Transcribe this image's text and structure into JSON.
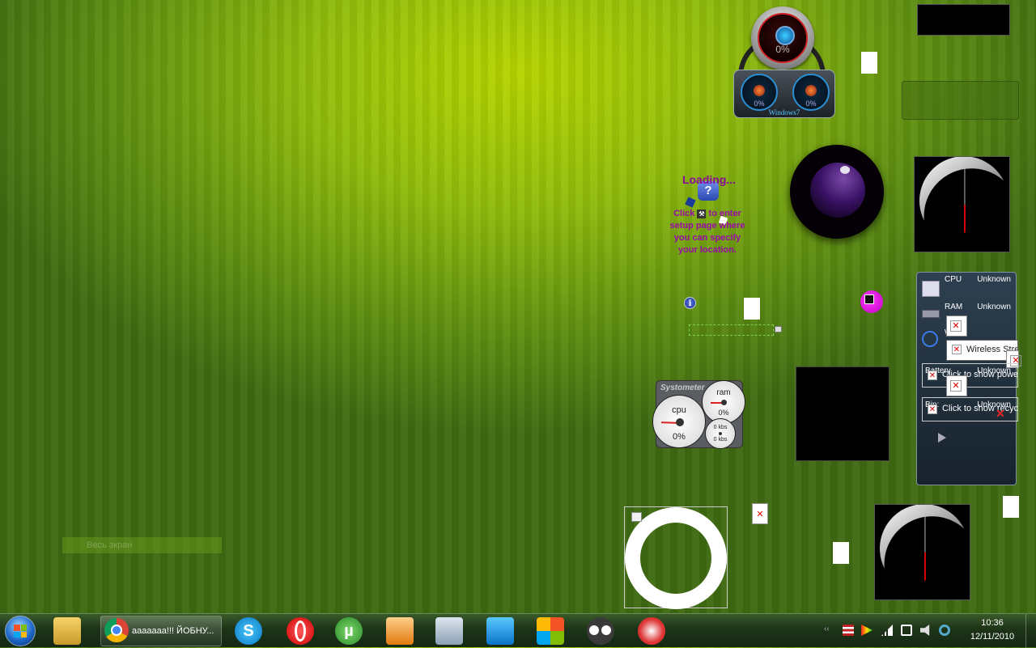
{
  "desktop": {
    "cpu_meter": {
      "cpu_percent": "0%",
      "core1_percent": "0%",
      "core2_percent": "0%",
      "brand": "Windows7"
    },
    "weather": {
      "loading_text": "Loading...",
      "msg_part1": "Click",
      "msg_part2": "to enter setup page where you can specify your location."
    },
    "fullscreen_label": "Весь экран",
    "systometer": {
      "title": "Systometer",
      "cpu_label": "cpu",
      "cpu_value": "0%",
      "ram_label": "ram",
      "ram_value": "0%",
      "net_up": "0 kbs",
      "net_down": "0 kbs"
    },
    "sysmon": {
      "cpu_label": "CPU",
      "cpu_value": "Unknown",
      "ram_label": "RAM",
      "ram_value": "Unknown",
      "wifi_label": "Wi",
      "wireless_text": "Wireless Stre",
      "battery_label": "Battery",
      "battery_value": "Unknown",
      "battery_link": "Click to show powe",
      "bin_label": "Bin:",
      "bin_value": "Unknown",
      "bin_link": "Click to show recyc"
    }
  },
  "taskbar": {
    "active_window_title": "ааааааа!!! ЙОБНУ...",
    "pinned_icons": [
      "explorer-icon",
      "chrome-icon",
      "skype-icon",
      "opera-icon",
      "utorrent-icon",
      "media-player-icon",
      "control-panel-icon",
      "downloader-icon",
      "windows-update-icon",
      "eyes-app-icon",
      "snipping-tool-icon"
    ],
    "tray_chevron": "‹‹",
    "time": "10:36",
    "date": "12/11/2010"
  }
}
